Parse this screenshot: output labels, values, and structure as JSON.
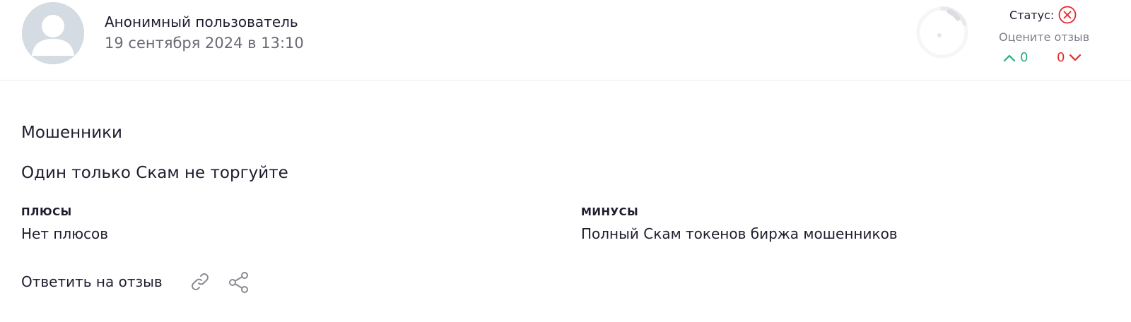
{
  "author": {
    "name": "Анонимный пользователь",
    "date": "19 сентября 2024 в 13:10"
  },
  "status": {
    "label": "Статус:",
    "icon": "rejected-x-circle-icon",
    "color": "#e5262a"
  },
  "rating": {
    "label": "Оцените отзыв",
    "upvotes": "0",
    "downvotes": "0",
    "up_color": "#21b07a",
    "down_color": "#e5262a"
  },
  "review": {
    "title": "Мошенники",
    "text": "Один только Скам не торгуйте",
    "pros_heading": "плюсы",
    "pros_text": "Нет плюсов",
    "cons_heading": "минусы",
    "cons_text": "Полный Скам токенов биржа мошенников"
  },
  "actions": {
    "reply_label": "Ответить на отзыв",
    "copy_link_icon": "link-icon",
    "share_icon": "share-icon"
  }
}
